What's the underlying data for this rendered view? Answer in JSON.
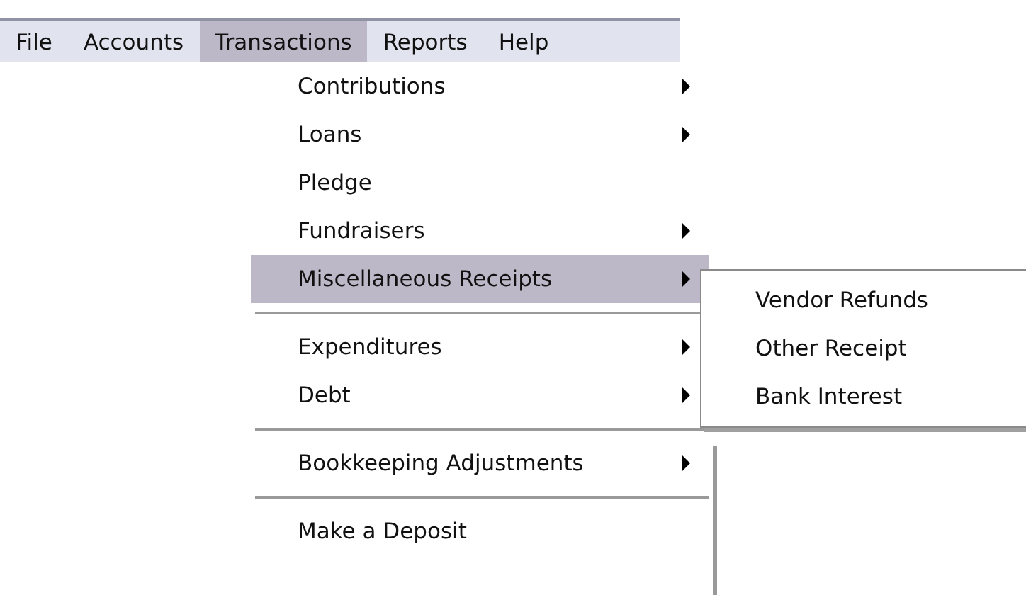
{
  "menubar": [
    {
      "label": "File",
      "selected": false
    },
    {
      "label": "Accounts",
      "selected": false
    },
    {
      "label": "Transactions",
      "selected": true
    },
    {
      "label": "Reports",
      "selected": false
    },
    {
      "label": "Help",
      "selected": false
    }
  ],
  "menu": [
    {
      "kind": "item",
      "label": "Contributions",
      "submenu": true,
      "selected": false
    },
    {
      "kind": "item",
      "label": "Loans",
      "submenu": true,
      "selected": false
    },
    {
      "kind": "item",
      "label": "Pledge",
      "submenu": false,
      "selected": false
    },
    {
      "kind": "item",
      "label": "Fundraisers",
      "submenu": true,
      "selected": false
    },
    {
      "kind": "item",
      "label": "Miscellaneous Receipts",
      "submenu": true,
      "selected": true
    },
    {
      "kind": "separator"
    },
    {
      "kind": "item",
      "label": "Expenditures",
      "submenu": true,
      "selected": false
    },
    {
      "kind": "item",
      "label": "Debt",
      "submenu": true,
      "selected": false
    },
    {
      "kind": "separator"
    },
    {
      "kind": "item",
      "label": "Bookkeeping Adjustments",
      "submenu": true,
      "selected": false
    },
    {
      "kind": "separator"
    },
    {
      "kind": "item",
      "label": "Make a Deposit",
      "submenu": false,
      "selected": false
    }
  ],
  "submenu": [
    {
      "label": "Vendor Refunds",
      "selected": false
    },
    {
      "label": "Other Receipt",
      "selected": false
    },
    {
      "label": "Bank Interest",
      "selected": false
    }
  ]
}
